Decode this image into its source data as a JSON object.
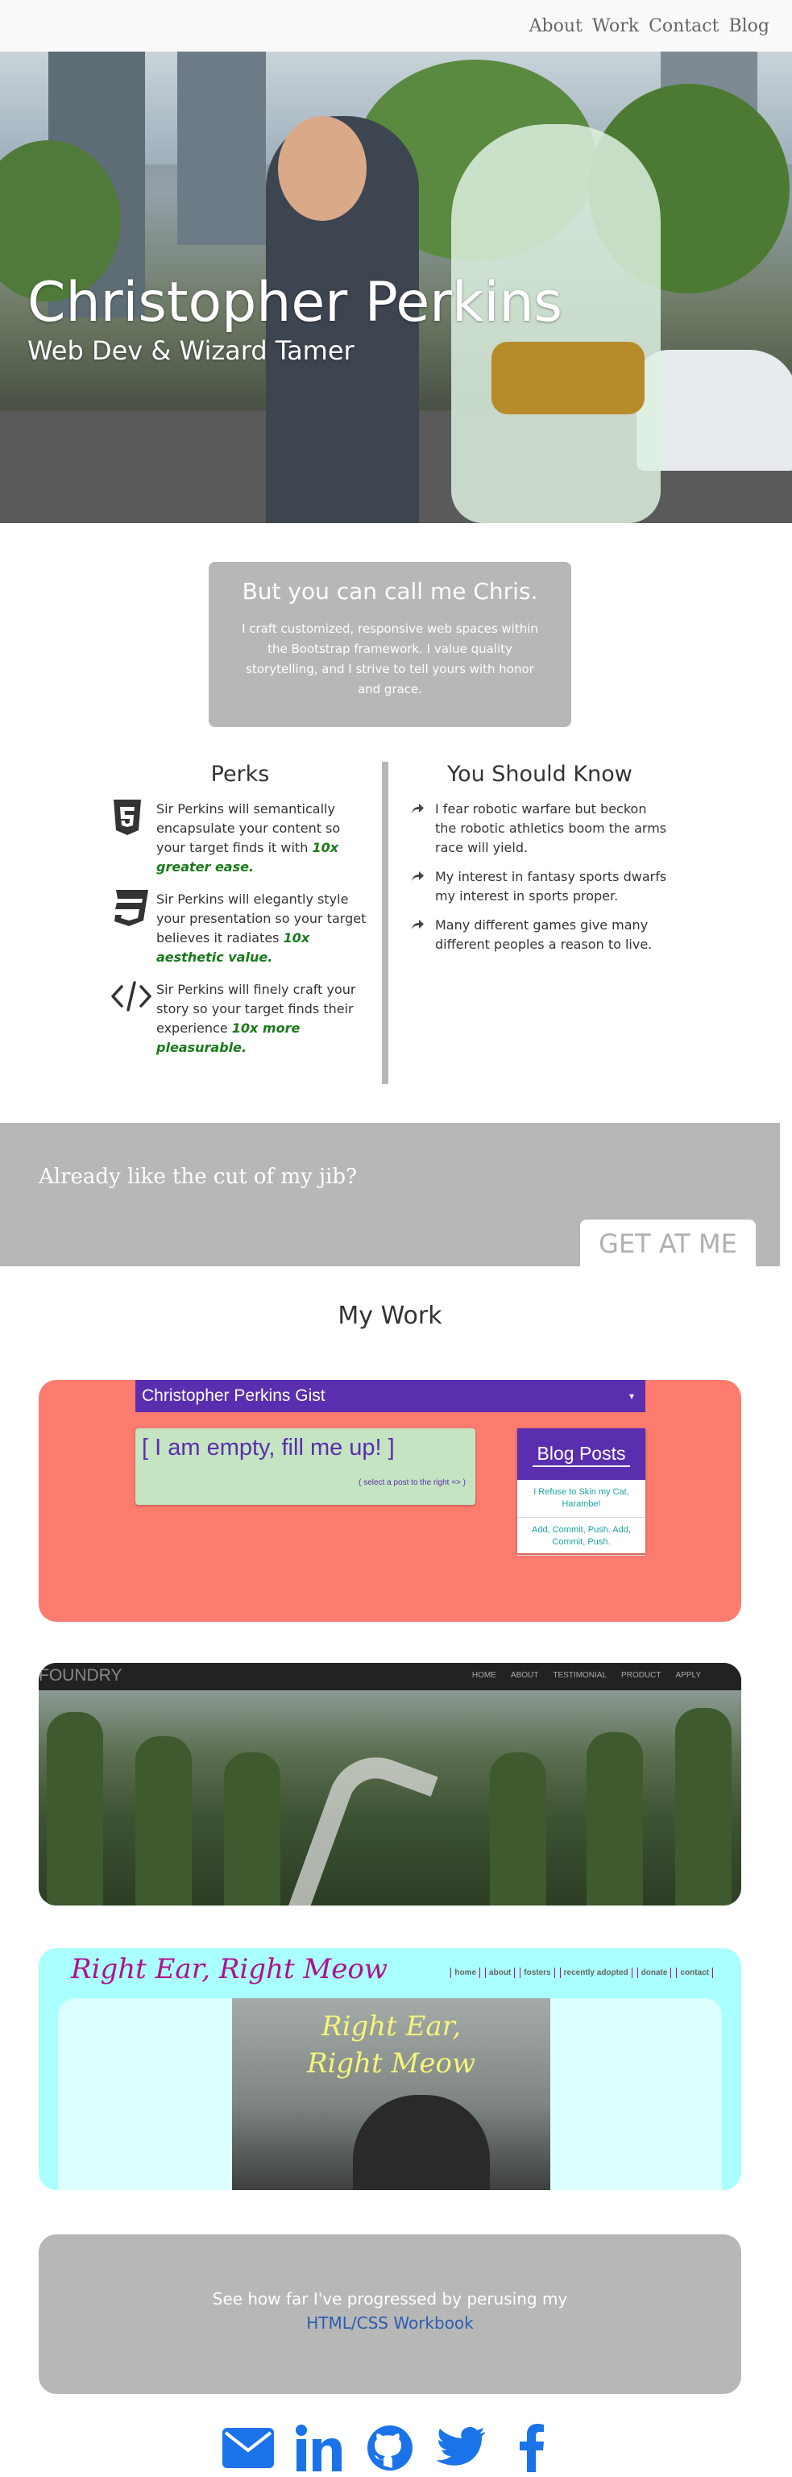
{
  "nav": {
    "links": [
      "About",
      "Work",
      "Contact",
      "Blog"
    ]
  },
  "hero": {
    "title": "Christopher Perkins",
    "subtitle": "Web Dev & Wizard Tamer"
  },
  "intro": {
    "heading": "But you can call me Chris.",
    "body": "I craft customized, responsive web spaces within the Bootstrap framework. I value quality storytelling, and I strive to tell yours with honor and grace."
  },
  "perks": {
    "title": "Perks",
    "items": [
      {
        "icon": "html5-icon",
        "text": "Sir Perkins will semantically encapsulate your content so your target finds it with ",
        "emphasis": "10x greater ease."
      },
      {
        "icon": "css3-icon",
        "text": "Sir Perkins will elegantly style your presentation so your target believes it radiates ",
        "emphasis": "10x aesthetic value."
      },
      {
        "icon": "code-icon",
        "text": "Sir Perkins will finely craft your story so your target finds their experience ",
        "emphasis": "10x more pleasurable."
      }
    ]
  },
  "know": {
    "title": "You Should Know",
    "items": [
      "I fear robotic warfare but beckon the robotic athletics boom the arms race will yield.",
      "My interest in fantasy sports dwarfs my interest in sports proper.",
      "Many different games give many different peoples a reason to live."
    ]
  },
  "cta": {
    "text": "Already like the cut of my jib?",
    "button": "GET AT ME"
  },
  "work": {
    "title": "My Work",
    "gist": {
      "title": "Christopher Perkins Gist",
      "caret": "▾",
      "empty": "[ I am empty, fill me up! ]",
      "hint": "( select a post to the right => )",
      "posts_title": "Blog Posts",
      "posts": [
        "I Refuse to Skin my Cat, Harambe!",
        "Add, Commit, Push. Add, Commit, Push."
      ]
    },
    "foundry": {
      "logo": "FOUNDRY",
      "links": [
        "HOME",
        "ABOUT",
        "TESTIMONIAL",
        "PRODUCT",
        "APPLY"
      ]
    },
    "cat": {
      "title": "Right Ear, Right Meow",
      "links": [
        "home",
        "about",
        "fosters",
        "recently adopted",
        "donate",
        "contact"
      ],
      "image_title_1": "Right Ear,",
      "image_title_2": "Right Meow"
    }
  },
  "workbook": {
    "text": "See how far I've progressed by perusing my",
    "link": "HTML/CSS Workbook"
  },
  "social": [
    "mail-icon",
    "linkedin-icon",
    "github-icon",
    "twitter-icon",
    "facebook-icon"
  ],
  "colors": {
    "accent_purple": "#5a2eae",
    "salmon": "#fd7c6e",
    "cyan": "#aaffff",
    "gray_card": "#b7b7b7",
    "social_blue": "#1a73e8"
  }
}
